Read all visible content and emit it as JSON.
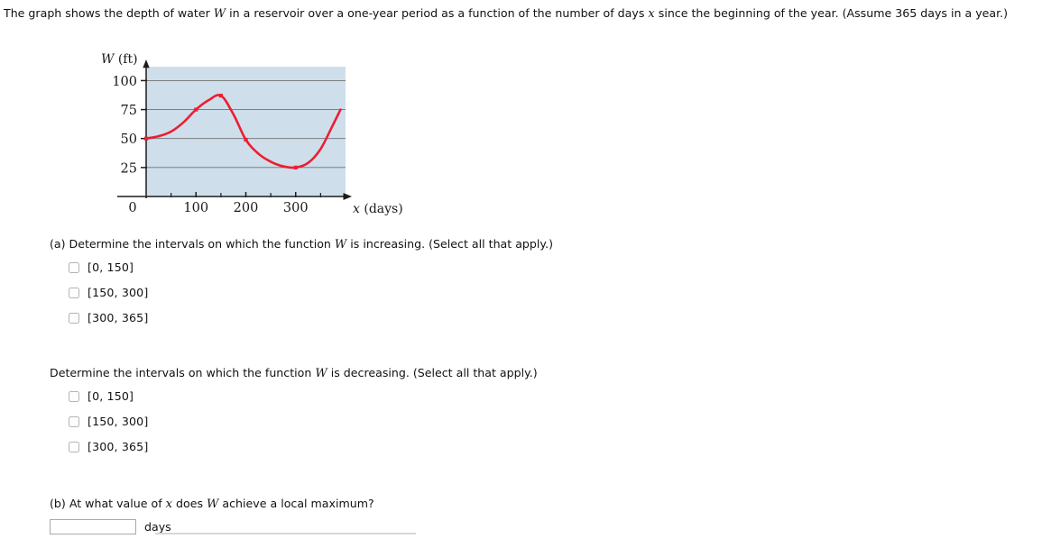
{
  "problem": {
    "stem_part1": "The graph shows the depth of water ",
    "stem_var_w": "W",
    "stem_part2": " in a reservoir over a one-year period as a function of the number of days ",
    "stem_var_x": "x",
    "stem_part3": " since the beginning of the year. (Assume 365 days in a year.)"
  },
  "chart_data": {
    "type": "line",
    "title": "",
    "xlabel": "x (days)",
    "ylabel": "W (ft)",
    "xlabel_var": "x",
    "xlabel_unit": "(days)",
    "ylabel_var": "W",
    "ylabel_unit": "(ft)",
    "xlim": [
      0,
      400
    ],
    "ylim": [
      0,
      112
    ],
    "x_ticks_major": [
      0,
      100,
      200,
      300
    ],
    "x_tick_labels": [
      "0",
      "100",
      "200",
      "300"
    ],
    "x_ticks_minor": [
      50,
      150,
      250,
      350
    ],
    "y_ticks_major": [
      25,
      50,
      75,
      100
    ],
    "y_tick_labels": [
      "25",
      "50",
      "75",
      "100"
    ],
    "grid": "horizontal",
    "plot_bgcolor": "#cedfeb",
    "grid_color": "#6f6f6f",
    "line_color": "#ee1d31",
    "axis_color": "#1c1c1c",
    "legend": "none",
    "marked_points": [
      {
        "x": 0,
        "y": 50
      },
      {
        "x": 100,
        "y": 75
      },
      {
        "x": 150,
        "y": 87
      },
      {
        "x": 200,
        "y": 49
      },
      {
        "x": 300,
        "y": 25
      }
    ],
    "x": [
      0,
      25,
      50,
      75,
      100,
      125,
      150,
      175,
      200,
      225,
      250,
      275,
      300,
      325,
      350,
      375,
      390
    ],
    "values": [
      50,
      52,
      56,
      64,
      75,
      83,
      87,
      71,
      49,
      37,
      30,
      26,
      25,
      29,
      41,
      62,
      75
    ],
    "series": [
      {
        "name": "W(x)",
        "values": [
          50,
          52,
          56,
          64,
          75,
          83,
          87,
          71,
          49,
          37,
          30,
          26,
          25,
          29,
          41,
          62,
          75
        ]
      }
    ]
  },
  "question_a": {
    "prompt_prefix": "(a) Determine the intervals on which the function ",
    "prompt_var": "W",
    "prompt_suffix": " is increasing. (Select all that apply.)",
    "choices": [
      {
        "label": "[0, 150]",
        "checked": false
      },
      {
        "label": "[150, 300]",
        "checked": false
      },
      {
        "label": "[300, 365]",
        "checked": false
      }
    ]
  },
  "question_a2": {
    "prompt_prefix": "Determine the intervals on which the function ",
    "prompt_var": "W",
    "prompt_suffix": " is decreasing. (Select all that apply.)",
    "choices": [
      {
        "label": "[0, 150]",
        "checked": false
      },
      {
        "label": "[150, 300]",
        "checked": false
      },
      {
        "label": "[300, 365]",
        "checked": false
      }
    ]
  },
  "question_b": {
    "prompt_prefix": "(b) At what value of ",
    "prompt_var_x": "x",
    "prompt_mid": " does ",
    "prompt_var_w": "W",
    "prompt_suffix": " achieve a local maximum?",
    "input_value": "",
    "input_placeholder": "",
    "units_label": "days"
  }
}
